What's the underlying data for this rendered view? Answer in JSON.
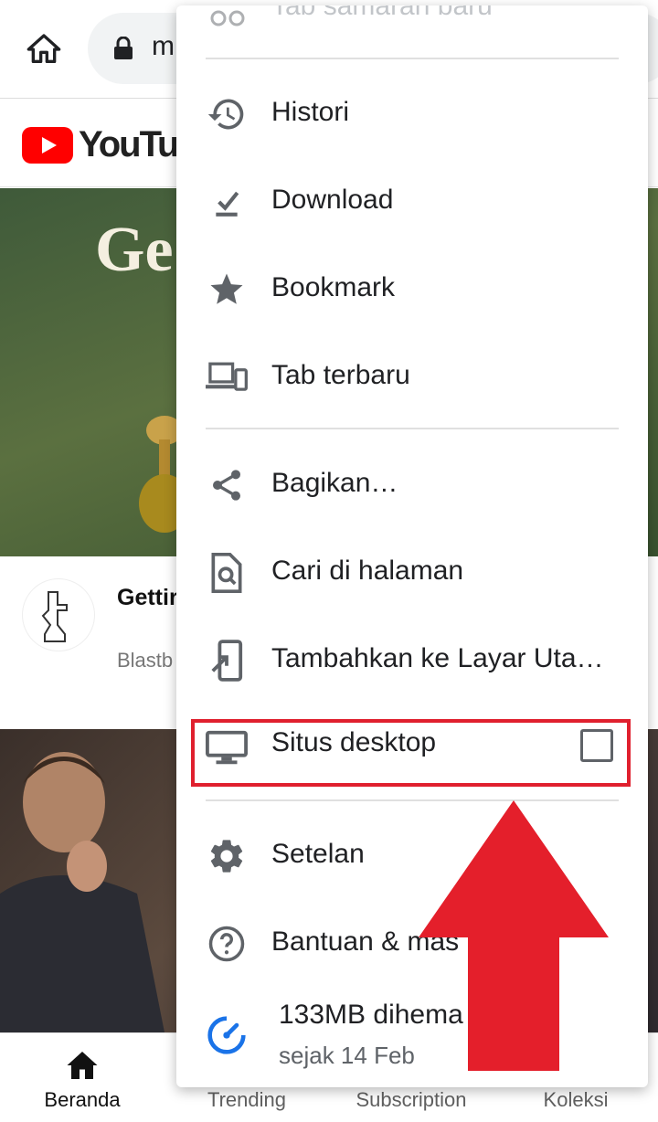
{
  "browser": {
    "url_text": "m",
    "icons": {
      "home": "home-icon",
      "lock": "lock-icon"
    }
  },
  "youtube": {
    "logo_text": "YouTube",
    "brand_color": "#ff0000",
    "video1": {
      "thumb_title": "Ge",
      "title": "Gettir Form",
      "meta": "Blastb yang la"
    }
  },
  "bottom_nav": {
    "items": [
      {
        "label": "Beranda",
        "icon": "home-filled-icon",
        "active": true
      },
      {
        "label": "Trending",
        "icon": "trending-icon",
        "active": false
      },
      {
        "label": "Subscription",
        "icon": "subscription-icon",
        "active": false
      },
      {
        "label": "Koleksi",
        "icon": "library-icon",
        "active": false
      }
    ]
  },
  "menu": {
    "partial_top_label": "Tab samaran baru",
    "items": [
      {
        "label": "Histori",
        "icon": "history-icon"
      },
      {
        "label": "Download",
        "icon": "download-icon"
      },
      {
        "label": "Bookmark",
        "icon": "star-icon"
      },
      {
        "label": "Tab terbaru",
        "icon": "devices-icon"
      },
      {
        "label": "Bagikan…",
        "icon": "share-icon"
      },
      {
        "label": "Cari di halaman",
        "icon": "find-in-page-icon"
      },
      {
        "label": "Tambahkan ke Layar Uta…",
        "icon": "add-to-home-icon"
      },
      {
        "label": "Situs desktop",
        "icon": "monitor-icon",
        "checked": false
      },
      {
        "label": "Setelan",
        "icon": "gear-icon"
      },
      {
        "label": "Bantuan & mas",
        "icon": "help-icon"
      }
    ],
    "data_saver": {
      "label": "133MB dihema",
      "sub": "sejak 14 Feb",
      "icon": "data-saver-icon",
      "accent": "#1a73e8"
    }
  },
  "annotation": {
    "color": "#e0202e"
  }
}
